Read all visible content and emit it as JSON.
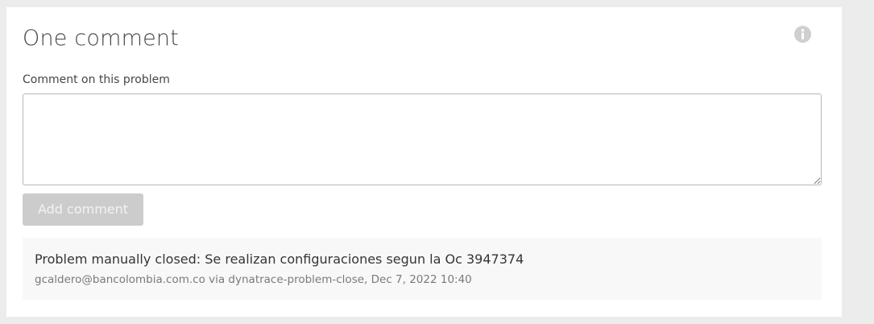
{
  "panel": {
    "title": "One comment",
    "info_icon": "info-circle-icon"
  },
  "form": {
    "label": "Comment on this problem",
    "textarea_value": "",
    "submit_label": "Add comment",
    "submit_disabled": true
  },
  "comments": [
    {
      "text": "Problem manually closed: Se realizan configuraciones segun la Oc 3947374",
      "meta": "gcaldero@bancolombia.com.co via dynatrace-problem-close, Dec 7, 2022 10:40"
    }
  ],
  "colors": {
    "background": "#ececec",
    "card": "#ffffff",
    "button_disabled": "#cccccc",
    "comment_bg": "#f8f8f8",
    "icon": "#c8c8c8"
  }
}
